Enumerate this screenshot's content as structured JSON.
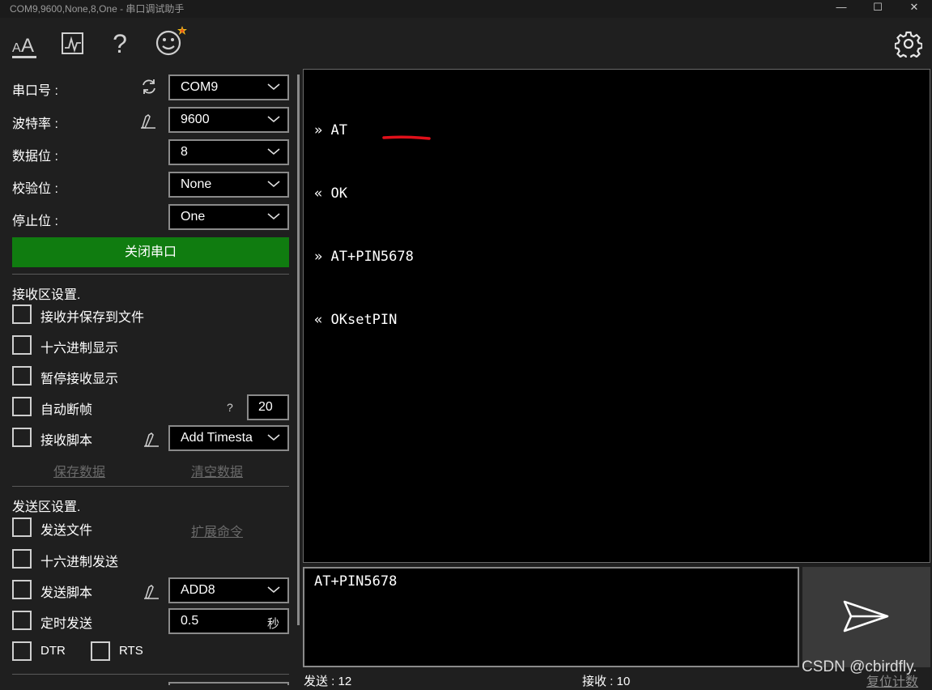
{
  "window": {
    "title": "COM9,9600,None,8,One - 串口调试助手",
    "controls": {
      "minimize": "—",
      "maximize": "☐",
      "close": "✕"
    }
  },
  "toolbar": {
    "icons": [
      "font-size-icon",
      "chart-icon",
      "help-icon",
      "smiley-icon",
      "settings-icon"
    ],
    "help_glyph": "?"
  },
  "serial": {
    "port_label": "串口号 :",
    "port_value": "COM9",
    "baud_label": "波特率 :",
    "baud_value": "9600",
    "databits_label": "数据位 :",
    "databits_value": "8",
    "parity_label": "校验位 :",
    "parity_value": "None",
    "stopbits_label": "停止位 :",
    "stopbits_value": "One",
    "close_button": "关闭串口"
  },
  "receive": {
    "section_title": "接收区设置.",
    "save_to_file": "接收并保存到文件",
    "hex_display": "十六进制显示",
    "pause_display": "暂停接收显示",
    "auto_frame": "自动断帧",
    "auto_frame_help": "?",
    "auto_frame_value": "20",
    "script_label": "接收脚本",
    "script_value": "Add Timesta",
    "save_data": "保存数据",
    "clear_data": "清空数据"
  },
  "send": {
    "section_title": "发送区设置.",
    "send_file": "发送文件",
    "extend_cmd": "扩展命令",
    "hex_send": "十六进制发送",
    "script_label": "发送脚本",
    "script_value": "ADD8",
    "timed_send": "定时发送",
    "timed_value": "0.5",
    "timed_unit": "秒",
    "dtr": "DTR",
    "rts": "RTS"
  },
  "terminal": {
    "lines": [
      {
        "dir": "»",
        "text": "AT"
      },
      {
        "dir": "«",
        "text": "OK"
      },
      {
        "dir": "»",
        "text": "AT+PIN5678"
      },
      {
        "dir": "«",
        "text": "OKsetPIN"
      }
    ]
  },
  "input": {
    "value": "AT+PIN5678"
  },
  "status": {
    "sent": "发送 : 12",
    "received": "接收 : 10",
    "reset_count": "复位计数"
  },
  "watermark": "CSDN @cbirdfly.",
  "colors": {
    "accent_green": "#107c10",
    "annotation_red": "#e0101a"
  }
}
